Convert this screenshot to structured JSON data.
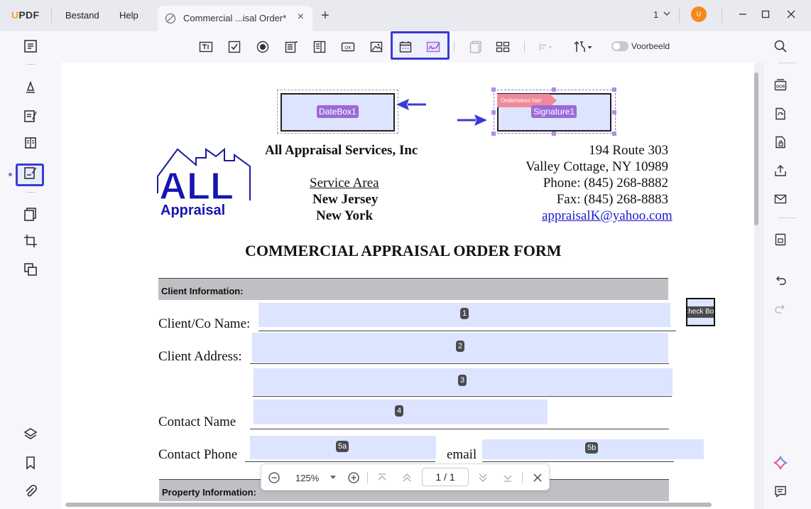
{
  "app": {
    "logo": "UPDF",
    "menu": [
      "Bestand",
      "Help"
    ],
    "tab_title": "Commercial ...isal Order*",
    "page_indicator": "1",
    "avatar_initial": "U",
    "accent": "#3a3ad6"
  },
  "toolbar": {
    "tools": [
      "text-field-icon",
      "checkbox-icon",
      "radio-button-icon",
      "combo-box-icon",
      "list-box-icon",
      "button-icon",
      "image-field-icon",
      "date-field-icon",
      "signature-field-icon"
    ],
    "voorbeeld_label": "Voorbeeld"
  },
  "document": {
    "fields": {
      "datebox": "DateBox1",
      "signature": "Signature1",
      "signature_flag": "Onderteken hier",
      "checkbox": "Check Box",
      "f1": "1",
      "f2": "2",
      "f3": "3",
      "f4": "4",
      "f5a": "5a",
      "f5b": "5b"
    },
    "company": "All Appraisal Services, Inc",
    "logo_big": "ALL",
    "logo_small": "Appraisal",
    "service_area_title": "Service Area",
    "service_area_1": "New Jersey",
    "service_area_2": "New York",
    "address_1": "194 Route 303",
    "address_2": "Valley Cottage, NY 10989",
    "phone": "Phone:  (845) 268-8882",
    "fax": "Fax:  (845) 268-8883",
    "email": "appraisalK@yahoo.com",
    "form_title": "COMMERCIAL APPRAISAL ORDER FORM",
    "section_client": "Client Information:",
    "label_client_name": "Client/Co Name:",
    "label_client_address": "Client Address:",
    "label_contact_name": "Contact Name",
    "label_contact_phone": "Contact Phone",
    "label_email": "email",
    "section_property": "Property Information:"
  },
  "zoombar": {
    "zoom": "125%",
    "page": "1 / 1"
  }
}
